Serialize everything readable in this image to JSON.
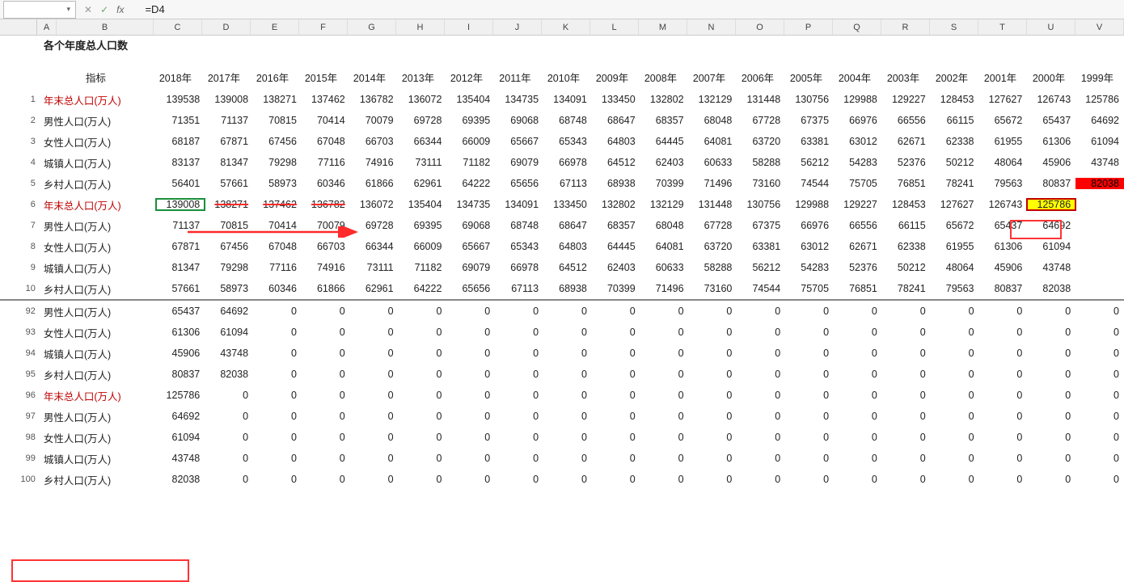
{
  "formula_bar": {
    "name_box": "",
    "fx": "fx",
    "formula": "=D4"
  },
  "columns": [
    "A",
    "B",
    "C",
    "D",
    "E",
    "F",
    "G",
    "H",
    "I",
    "J",
    "K",
    "L",
    "M",
    "N",
    "O",
    "P",
    "Q",
    "R",
    "S",
    "T",
    "U",
    "V"
  ],
  "col_widths": {
    "A": 24,
    "B": 120,
    "C": 60,
    "D": 60,
    "E": 60,
    "F": 60,
    "G": 60,
    "H": 60,
    "I": 60,
    "J": 60,
    "K": 60,
    "L": 60,
    "M": 60,
    "N": 60,
    "O": 60,
    "P": 60,
    "Q": 60,
    "R": 60,
    "S": 60,
    "T": 60,
    "U": 60,
    "V": 60
  },
  "title": "各个年度总人口数",
  "header_label": "指标",
  "years": [
    "2018年",
    "2017年",
    "2016年",
    "2015年",
    "2014年",
    "2013年",
    "2012年",
    "2011年",
    "2010年",
    "2009年",
    "2008年",
    "2007年",
    "2006年",
    "2005年",
    "2004年",
    "2003年",
    "2002年",
    "2001年",
    "2000年",
    "1999年"
  ],
  "rows_top": [
    {
      "n": "1",
      "label": "年末总人口(万人)",
      "red": true,
      "vals": [
        "139538",
        "139008",
        "138271",
        "137462",
        "136782",
        "136072",
        "135404",
        "134735",
        "134091",
        "133450",
        "132802",
        "132129",
        "131448",
        "130756",
        "129988",
        "129227",
        "128453",
        "127627",
        "126743",
        "125786"
      ]
    },
    {
      "n": "2",
      "label": "男性人口(万人)",
      "vals": [
        "71351",
        "71137",
        "70815",
        "70414",
        "70079",
        "69728",
        "69395",
        "69068",
        "68748",
        "68647",
        "68357",
        "68048",
        "67728",
        "67375",
        "66976",
        "66556",
        "66115",
        "65672",
        "65437",
        "64692"
      ]
    },
    {
      "n": "3",
      "label": "女性人口(万人)",
      "vals": [
        "68187",
        "67871",
        "67456",
        "67048",
        "66703",
        "66344",
        "66009",
        "65667",
        "65343",
        "64803",
        "64445",
        "64081",
        "63720",
        "63381",
        "63012",
        "62671",
        "62338",
        "61955",
        "61306",
        "61094"
      ]
    },
    {
      "n": "4",
      "label": "城镇人口(万人)",
      "vals": [
        "83137",
        "81347",
        "79298",
        "77116",
        "74916",
        "73111",
        "71182",
        "69079",
        "66978",
        "64512",
        "62403",
        "60633",
        "58288",
        "56212",
        "54283",
        "52376",
        "50212",
        "48064",
        "45906",
        "43748"
      ]
    },
    {
      "n": "5",
      "label": "乡村人口(万人)",
      "vals": [
        "56401",
        "57661",
        "58973",
        "60346",
        "61866",
        "62961",
        "64222",
        "65656",
        "67113",
        "68938",
        "70399",
        "71496",
        "73160",
        "74544",
        "75705",
        "76851",
        "78241",
        "79563",
        "80837",
        "82038"
      ],
      "lastRedFill": true
    },
    {
      "n": "6",
      "label": "年末总人口(万人)",
      "red": true,
      "vals": [
        "139008",
        "138271",
        "137462",
        "136782",
        "136072",
        "135404",
        "134735",
        "134091",
        "133450",
        "132802",
        "132129",
        "131448",
        "130756",
        "129988",
        "129227",
        "128453",
        "127627",
        "126743",
        "125786",
        ""
      ],
      "sel": 0,
      "strike": [
        1,
        2,
        3
      ],
      "yellow": 18
    },
    {
      "n": "7",
      "label": "男性人口(万人)",
      "vals": [
        "71137",
        "70815",
        "70414",
        "70079",
        "69728",
        "69395",
        "69068",
        "68748",
        "68647",
        "68357",
        "68048",
        "67728",
        "67375",
        "66976",
        "66556",
        "66115",
        "65672",
        "65437",
        "64692",
        ""
      ]
    },
    {
      "n": "8",
      "label": "女性人口(万人)",
      "vals": [
        "67871",
        "67456",
        "67048",
        "66703",
        "66344",
        "66009",
        "65667",
        "65343",
        "64803",
        "64445",
        "64081",
        "63720",
        "63381",
        "63012",
        "62671",
        "62338",
        "61955",
        "61306",
        "61094",
        ""
      ]
    },
    {
      "n": "9",
      "label": "城镇人口(万人)",
      "vals": [
        "81347",
        "79298",
        "77116",
        "74916",
        "73111",
        "71182",
        "69079",
        "66978",
        "64512",
        "62403",
        "60633",
        "58288",
        "56212",
        "54283",
        "52376",
        "50212",
        "48064",
        "45906",
        "43748",
        ""
      ]
    },
    {
      "n": "10",
      "label": "乡村人口(万人)",
      "vals": [
        "57661",
        "58973",
        "60346",
        "61866",
        "62961",
        "64222",
        "65656",
        "67113",
        "68938",
        "70399",
        "71496",
        "73160",
        "74544",
        "75705",
        "76851",
        "78241",
        "79563",
        "80837",
        "82038",
        ""
      ]
    }
  ],
  "rows_bottom": [
    {
      "n": "92",
      "label": "男性人口(万人)",
      "vals": [
        "65437",
        "64692",
        "0",
        "0",
        "0",
        "0",
        "0",
        "0",
        "0",
        "0",
        "0",
        "0",
        "0",
        "0",
        "0",
        "0",
        "0",
        "0",
        "0",
        "0"
      ]
    },
    {
      "n": "93",
      "label": "女性人口(万人)",
      "vals": [
        "61306",
        "61094",
        "0",
        "0",
        "0",
        "0",
        "0",
        "0",
        "0",
        "0",
        "0",
        "0",
        "0",
        "0",
        "0",
        "0",
        "0",
        "0",
        "0",
        "0"
      ]
    },
    {
      "n": "94",
      "label": "城镇人口(万人)",
      "vals": [
        "45906",
        "43748",
        "0",
        "0",
        "0",
        "0",
        "0",
        "0",
        "0",
        "0",
        "0",
        "0",
        "0",
        "0",
        "0",
        "0",
        "0",
        "0",
        "0",
        "0"
      ]
    },
    {
      "n": "95",
      "label": "乡村人口(万人)",
      "vals": [
        "80837",
        "82038",
        "0",
        "0",
        "0",
        "0",
        "0",
        "0",
        "0",
        "0",
        "0",
        "0",
        "0",
        "0",
        "0",
        "0",
        "0",
        "0",
        "0",
        "0"
      ]
    },
    {
      "n": "96",
      "label": "年末总人口(万人)",
      "red": true,
      "vals": [
        "125786",
        "0",
        "0",
        "0",
        "0",
        "0",
        "0",
        "0",
        "0",
        "0",
        "0",
        "0",
        "0",
        "0",
        "0",
        "0",
        "0",
        "0",
        "0",
        "0"
      ]
    },
    {
      "n": "97",
      "label": "男性人口(万人)",
      "vals": [
        "64692",
        "0",
        "0",
        "0",
        "0",
        "0",
        "0",
        "0",
        "0",
        "0",
        "0",
        "0",
        "0",
        "0",
        "0",
        "0",
        "0",
        "0",
        "0",
        "0"
      ]
    },
    {
      "n": "98",
      "label": "女性人口(万人)",
      "vals": [
        "61094",
        "0",
        "0",
        "0",
        "0",
        "0",
        "0",
        "0",
        "0",
        "0",
        "0",
        "0",
        "0",
        "0",
        "0",
        "0",
        "0",
        "0",
        "0",
        "0"
      ]
    },
    {
      "n": "99",
      "label": "城镇人口(万人)",
      "vals": [
        "43748",
        "0",
        "0",
        "0",
        "0",
        "0",
        "0",
        "0",
        "0",
        "0",
        "0",
        "0",
        "0",
        "0",
        "0",
        "0",
        "0",
        "0",
        "0",
        "0"
      ]
    },
    {
      "n": "100",
      "label": "乡村人口(万人)",
      "vals": [
        "82038",
        "0",
        "0",
        "0",
        "0",
        "0",
        "0",
        "0",
        "0",
        "0",
        "0",
        "0",
        "0",
        "0",
        "0",
        "0",
        "0",
        "0",
        "0",
        "0"
      ]
    }
  ],
  "icons": {
    "cancel": "✕",
    "confirm": "✓"
  }
}
